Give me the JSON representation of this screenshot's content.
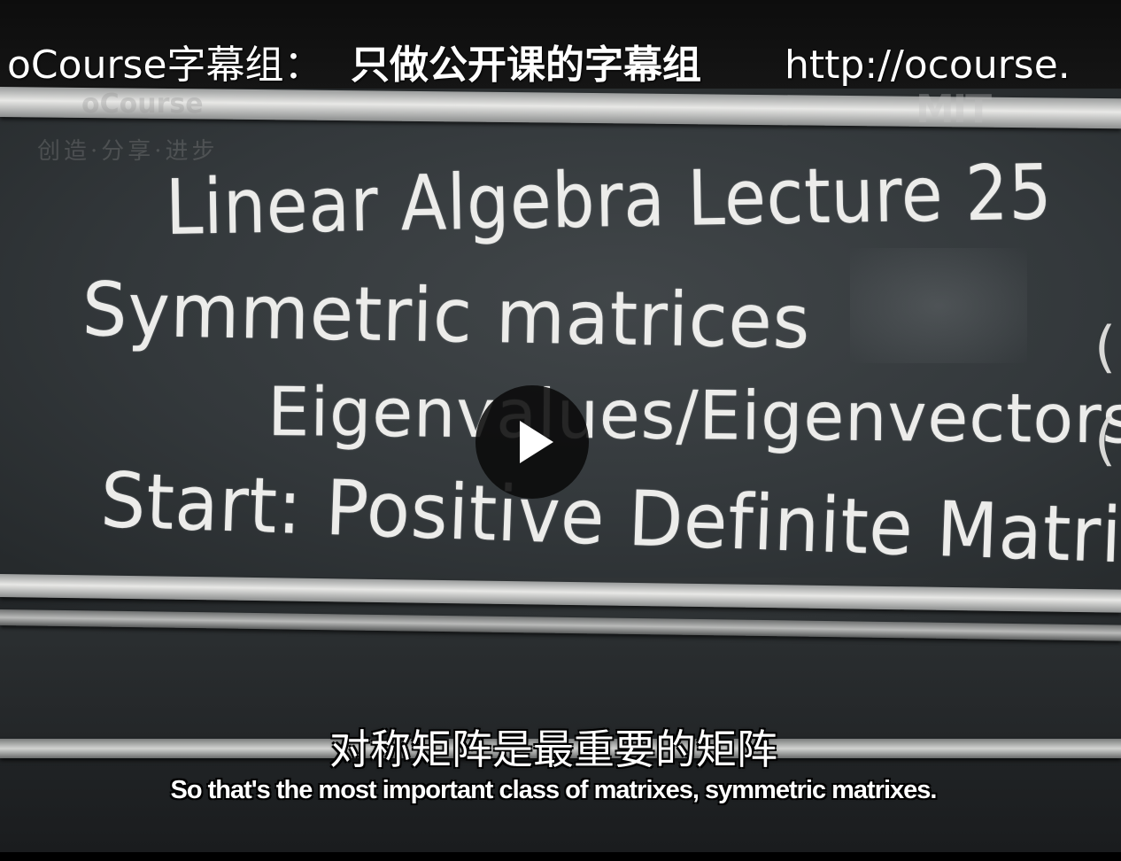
{
  "video": {
    "banner_site": "oCourse字幕组：",
    "banner_slogan": "只做公开课的字幕组",
    "banner_url": "http://ocourse.",
    "watermark_brand": "oCourse",
    "watermark_tagline": "创造·分享·进步",
    "watermark_logo": "MIT",
    "play_button_icon": "play-icon"
  },
  "blackboard": {
    "line1": "Linear Algebra Lecture 25",
    "line2": "Symmetric matrices",
    "line3": "Eigenvalues/Eigenvectors",
    "line4": "Start: Positive Definite Matrices"
  },
  "subtitles": {
    "chinese": "对称矩阵是最重要的矩阵",
    "english": "So that's the most important class of matrixes, symmetric matrixes."
  }
}
